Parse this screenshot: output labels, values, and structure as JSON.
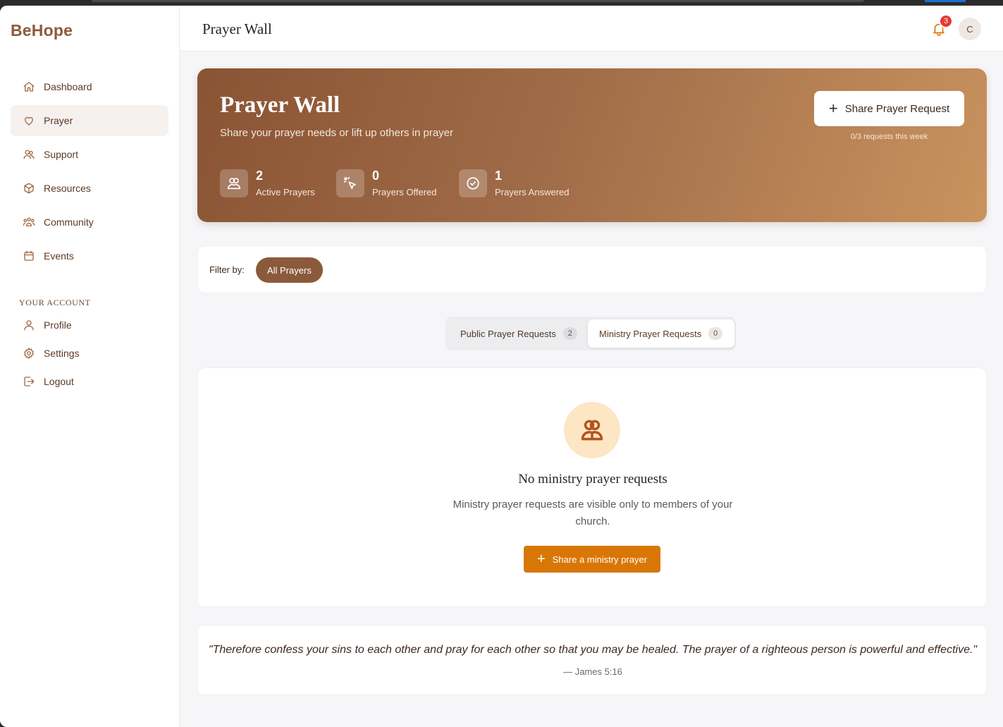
{
  "brand": "BeHope",
  "header": {
    "title": "Prayer Wall",
    "notification_count": "3",
    "avatar_initial": "C"
  },
  "sidebar": {
    "items": [
      {
        "label": "Dashboard",
        "icon": "home-icon"
      },
      {
        "label": "Prayer",
        "icon": "heart-icon",
        "active": true
      },
      {
        "label": "Support",
        "icon": "users-icon"
      },
      {
        "label": "Resources",
        "icon": "box-icon"
      },
      {
        "label": "Community",
        "icon": "community-icon"
      },
      {
        "label": "Events",
        "icon": "calendar-icon"
      }
    ],
    "account_label": "YOUR ACCOUNT",
    "account_items": [
      {
        "label": "Profile",
        "icon": "user-icon"
      },
      {
        "label": "Settings",
        "icon": "gear-icon"
      },
      {
        "label": "Logout",
        "icon": "logout-icon"
      }
    ]
  },
  "hero": {
    "title": "Prayer Wall",
    "subtitle": "Share your prayer needs or lift up others in prayer",
    "stats": [
      {
        "value": "2",
        "label": "Active Prayers",
        "icon": "people-icon"
      },
      {
        "value": "0",
        "label": "Prayers Offered",
        "icon": "click-icon"
      },
      {
        "value": "1",
        "label": "Prayers Answered",
        "icon": "check-circle-icon"
      }
    ],
    "share_button": "Share Prayer Request",
    "share_note": "0/3 requests this week"
  },
  "filter": {
    "label": "Filter by:",
    "active_chip": "All Prayers"
  },
  "tabs": [
    {
      "label": "Public Prayer Requests",
      "count": "2"
    },
    {
      "label": "Ministry Prayer Requests",
      "count": "0",
      "active": true
    }
  ],
  "empty_state": {
    "title": "No ministry prayer requests",
    "description": "Ministry prayer requests are visible only to members of your church.",
    "button": "Share a ministry prayer"
  },
  "quote": {
    "text": "\"Therefore confess your sins to each other and pray for each other so that you may be healed. The prayer of a righteous person is powerful and effective.\"",
    "reference": "— James 5:16"
  },
  "colors": {
    "brand": "#8b5a3c",
    "accent": "#d97706",
    "badge": "#e53935"
  }
}
